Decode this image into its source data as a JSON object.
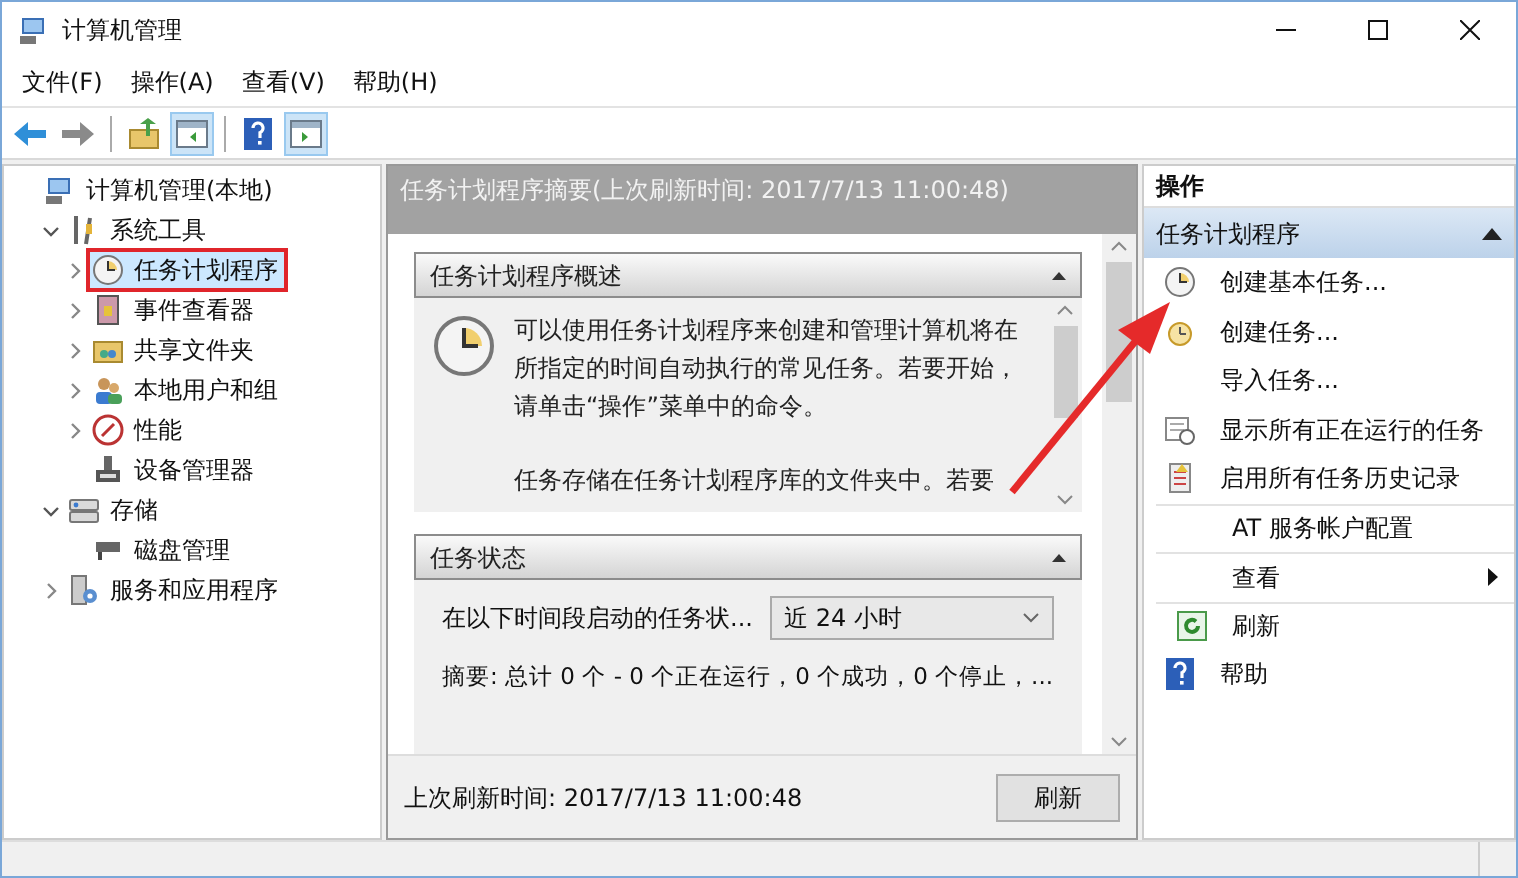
{
  "window": {
    "title": "计算机管理"
  },
  "menu": [
    "文件(F)",
    "操作(A)",
    "查看(V)",
    "帮助(H)"
  ],
  "toolbar": [
    {
      "kind": "back",
      "pressed": false
    },
    {
      "kind": "forward",
      "pressed": false
    },
    {
      "kind": "separator"
    },
    {
      "kind": "up",
      "pressed": false
    },
    {
      "kind": "tree-toggle",
      "pressed": true
    },
    {
      "kind": "separator"
    },
    {
      "kind": "help",
      "pressed": false
    },
    {
      "kind": "action-toggle",
      "pressed": true
    }
  ],
  "tree": [
    {
      "label": "计算机管理(本地)",
      "selected": false,
      "marked": false,
      "children": [
        {
          "label": "系统工具",
          "selected": false,
          "marked": false,
          "expanded": true,
          "children": [
            {
              "label": "任务计划程序",
              "selected": true,
              "marked": true,
              "expanded": false
            },
            {
              "label": "事件查看器",
              "selected": false,
              "marked": false,
              "expanded": false
            },
            {
              "label": "共享文件夹",
              "selected": false,
              "marked": false,
              "expanded": false
            },
            {
              "label": "本地用户和组",
              "selected": false,
              "marked": false,
              "expanded": false
            },
            {
              "label": "性能",
              "selected": false,
              "marked": false,
              "expanded": false
            },
            {
              "label": "设备管理器",
              "selected": false,
              "marked": false
            }
          ]
        },
        {
          "label": "存储",
          "selected": false,
          "marked": false,
          "expanded": true,
          "children": [
            {
              "label": "磁盘管理",
              "selected": false,
              "marked": false
            }
          ]
        },
        {
          "label": "服务和应用程序",
          "selected": false,
          "marked": false,
          "expanded": false
        }
      ]
    }
  ],
  "summary": {
    "header": "任务计划程序摘要(上次刷新时间: 2017/7/13 11:00:48)",
    "overview": {
      "title": "任务计划程序概述",
      "expanded": true,
      "paragraphs": [
        "可以使用任务计划程序来创建和管理计算机将在所指定的时间自动执行的常见任务。若要开始，请单击“操作”菜单中的命令。",
        "任务存储在任务计划程序库的文件夹中。若要"
      ]
    },
    "status": {
      "title": "任务状态",
      "expanded": true,
      "period_label": "在以下时间段启动的任务状...",
      "period_value": "近 24 小时",
      "summary": "摘要: 总计 0 个 - 0 个正在运行，0 个成功，0 个停止，..."
    },
    "footer": {
      "last_refresh": "上次刷新时间: 2017/7/13 11:00:48",
      "refresh_button": "刷新"
    }
  },
  "actions": {
    "header": "操作",
    "section": {
      "title": "任务计划程序",
      "expanded": true
    },
    "items": [
      {
        "label": "创建基本任务...",
        "kind": "basic-task",
        "separated": false
      },
      {
        "label": "创建任务...",
        "kind": "task",
        "separated": false
      },
      {
        "label": "导入任务...",
        "kind": "plain",
        "separated": false
      },
      {
        "label": "显示所有正在运行的任务",
        "kind": "running",
        "separated": false
      },
      {
        "label": "启用所有任务历史记录",
        "kind": "history",
        "separated": false
      },
      {
        "label": "AT 服务帐户配置",
        "kind": "plain",
        "separated": true
      },
      {
        "label": "查看",
        "kind": "submenu",
        "separated": true
      },
      {
        "label": "刷新",
        "kind": "refresh",
        "separated": true
      },
      {
        "label": "帮助",
        "kind": "help",
        "separated": false
      }
    ]
  },
  "annotation": {
    "arrow": true
  }
}
